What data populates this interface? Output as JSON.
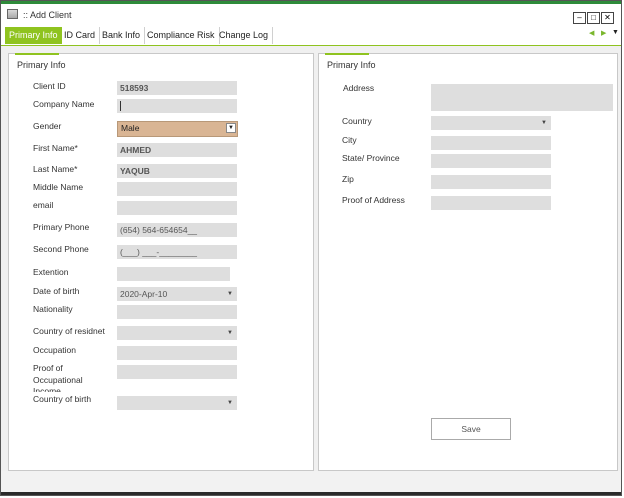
{
  "window": {
    "title": "::  Add Client"
  },
  "tabs": [
    {
      "label": "Primary Info",
      "active": true
    },
    {
      "label": "ID Card"
    },
    {
      "label": "Bank Info"
    },
    {
      "label": "Compliance Risk"
    },
    {
      "label": "Change Log"
    }
  ],
  "left_panel": {
    "title": "Primary Info",
    "labels": {
      "client_id": "Client ID",
      "company_name": "Company Name",
      "gender": "Gender",
      "first_name": "First Name*",
      "last_name": "Last Name*",
      "middle_name": "Middle Name",
      "email": "email",
      "primary_phone": "Primary Phone",
      "second_phone": "Second Phone",
      "extension": "Extention",
      "date_of_birth": "Date of birth",
      "nationality": "Nationality",
      "country_of_residence": "Country of residnet",
      "occupation": "Occupation",
      "proof_of_income_1": "Proof of",
      "proof_of_income_2": "Occupational",
      "proof_of_income_3": "Income",
      "country_of_birth": "Country of birth"
    },
    "values": {
      "client_id": "518593",
      "company_name": "",
      "gender": "Male",
      "first_name": "AHMED",
      "last_name": "YAQUB",
      "middle_name": "",
      "email": "",
      "primary_phone": "(654) 564-654654__",
      "second_phone": "(___) ___-________",
      "extension": "",
      "date_of_birth": "2020-Apr-10",
      "nationality": "",
      "country_of_residence": "",
      "occupation": "",
      "proof_of_income": "",
      "country_of_birth": ""
    }
  },
  "right_panel": {
    "title": "Primary Info",
    "labels": {
      "address": "Address",
      "country": "Country",
      "city": "City",
      "state": "State/ Province",
      "zip": "Zip",
      "proof_of_address": "Proof of Address"
    },
    "values": {
      "address": "",
      "country": "",
      "city": "",
      "state": "",
      "zip": "",
      "proof_of_address": ""
    },
    "save_label": "Save"
  },
  "icons": {
    "app": "app-window-icon",
    "minimize": "minimize-icon",
    "maximize": "maximize-icon",
    "close": "close-icon",
    "dropdown": "chevron-down-icon"
  },
  "colors": {
    "accent": "#8fc31f",
    "gender_field": "#d9b594",
    "field_bg": "#dedede"
  }
}
